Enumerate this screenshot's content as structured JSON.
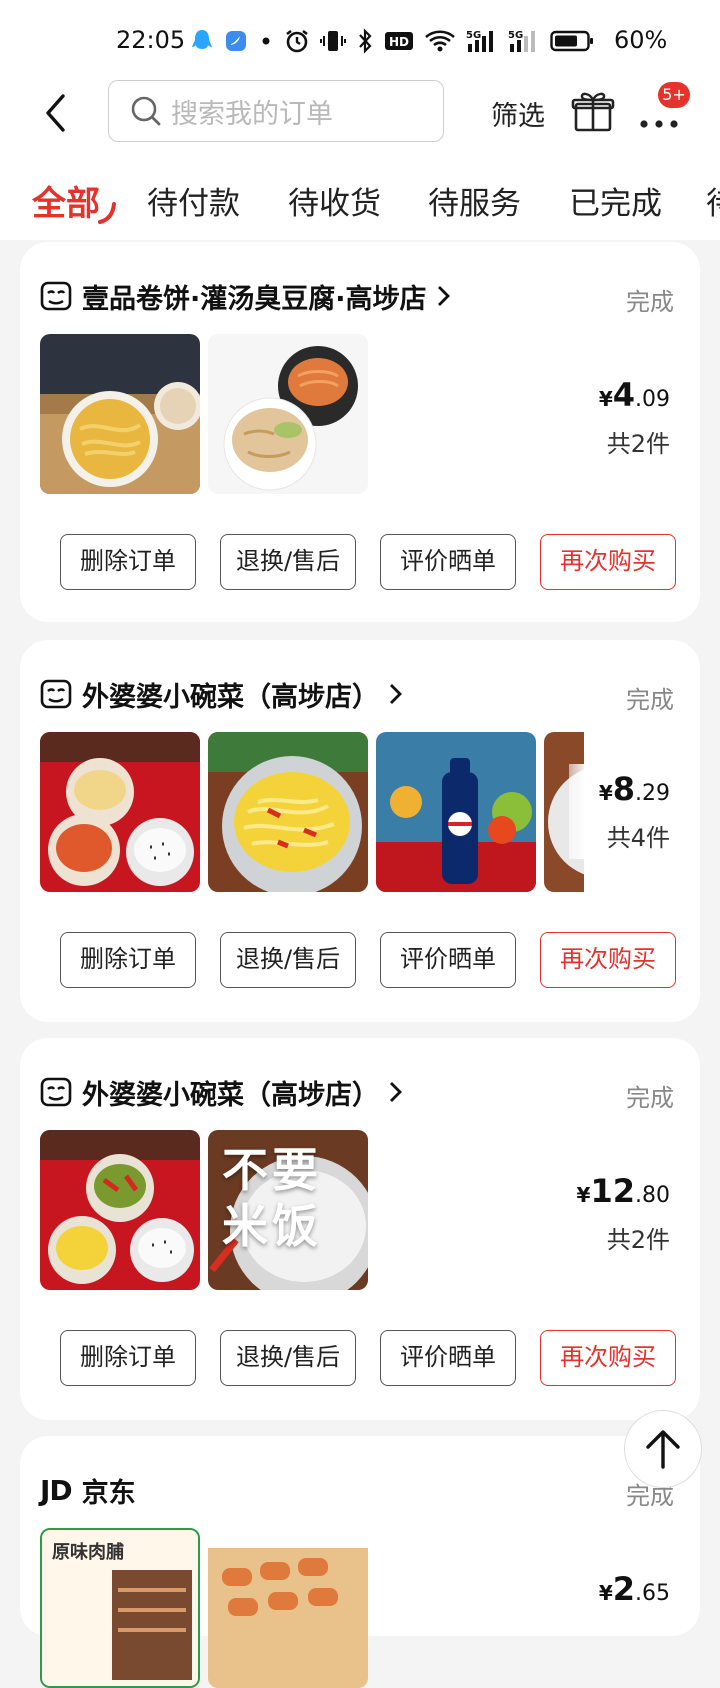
{
  "status_bar": {
    "time": "22:05",
    "battery": "60%",
    "icons": [
      "qq-icon",
      "app-icon",
      "dot-icon",
      "alarm-icon",
      "vibrate-icon",
      "bluetooth-icon",
      "hd-icon",
      "wifi-icon",
      "signal-5g-icon",
      "signal-5g-icon",
      "battery-icon"
    ]
  },
  "header": {
    "search_placeholder": "搜索我的订单",
    "filter_label": "筛选",
    "badge": "5+"
  },
  "tabs": [
    {
      "label": "全部",
      "active": true
    },
    {
      "label": "待付款",
      "active": false
    },
    {
      "label": "待收货",
      "active": false
    },
    {
      "label": "待服务",
      "active": false
    },
    {
      "label": "已完成",
      "active": false
    },
    {
      "label": "待",
      "active": false
    }
  ],
  "action_labels": {
    "delete": "删除订单",
    "return": "退换/售后",
    "review": "评价晒单",
    "rebuy": "再次购买"
  },
  "orders": [
    {
      "store": "壹品卷饼·灌汤臭豆腐·高埗店",
      "status": "完成",
      "price_symbol": "¥",
      "price_int": "4",
      "price_dec": ".09",
      "count": "共2件"
    },
    {
      "store": "外婆婆小碗菜（高埗店）",
      "status": "完成",
      "price_symbol": "¥",
      "price_int": "8",
      "price_dec": ".29",
      "count": "共4件"
    },
    {
      "store": "外婆婆小碗菜（高埗店）",
      "status": "完成",
      "price_symbol": "¥",
      "price_int": "12",
      "price_dec": ".80",
      "count": "共2件",
      "thumb_text": "不要\n米饭"
    },
    {
      "store_logo": "JD",
      "store": "京东",
      "status": "完成",
      "price_symbol": "¥",
      "price_int": "2",
      "price_dec": ".65",
      "thumb_text": "原味肉脯"
    }
  ],
  "colors": {
    "accent": "#e5322d",
    "background": "#f4f4f4"
  }
}
